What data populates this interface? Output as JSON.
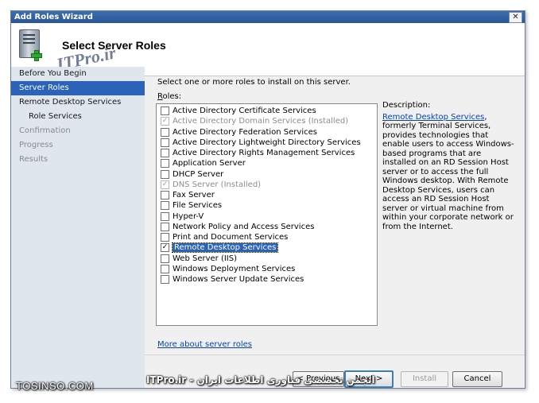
{
  "window": {
    "title": "Add Roles Wizard",
    "close_glyph": "✕"
  },
  "header": {
    "title": "Select Server Roles",
    "watermark": "ITPro.ir"
  },
  "sidebar": {
    "items": [
      {
        "label": "Before You Begin",
        "state": "normal",
        "indent": 0
      },
      {
        "label": "Server Roles",
        "state": "active",
        "indent": 0
      },
      {
        "label": "Remote Desktop Services",
        "state": "normal",
        "indent": 0
      },
      {
        "label": "Role Services",
        "state": "normal",
        "indent": 1
      },
      {
        "label": "Confirmation",
        "state": "disabled",
        "indent": 0
      },
      {
        "label": "Progress",
        "state": "disabled",
        "indent": 0
      },
      {
        "label": "Results",
        "state": "disabled",
        "indent": 0
      }
    ]
  },
  "main": {
    "instruction": "Select one or more roles to install on this server.",
    "roles_label_access": "R",
    "roles_label_rest": "oles:",
    "roles": [
      {
        "label": "Active Directory Certificate Services",
        "checked": false,
        "disabled": false,
        "selected": false
      },
      {
        "label": "Active Directory Domain Services  (Installed)",
        "checked": true,
        "disabled": true,
        "selected": false
      },
      {
        "label": "Active Directory Federation Services",
        "checked": false,
        "disabled": false,
        "selected": false
      },
      {
        "label": "Active Directory Lightweight Directory Services",
        "checked": false,
        "disabled": false,
        "selected": false
      },
      {
        "label": "Active Directory Rights Management Services",
        "checked": false,
        "disabled": false,
        "selected": false
      },
      {
        "label": "Application Server",
        "checked": false,
        "disabled": false,
        "selected": false
      },
      {
        "label": "DHCP Server",
        "checked": false,
        "disabled": false,
        "selected": false
      },
      {
        "label": "DNS Server  (Installed)",
        "checked": true,
        "disabled": true,
        "selected": false
      },
      {
        "label": "Fax Server",
        "checked": false,
        "disabled": false,
        "selected": false
      },
      {
        "label": "File Services",
        "checked": false,
        "disabled": false,
        "selected": false
      },
      {
        "label": "Hyper-V",
        "checked": false,
        "disabled": false,
        "selected": false
      },
      {
        "label": "Network Policy and Access Services",
        "checked": false,
        "disabled": false,
        "selected": false
      },
      {
        "label": "Print and Document Services",
        "checked": false,
        "disabled": false,
        "selected": false
      },
      {
        "label": "Remote Desktop Services",
        "checked": true,
        "disabled": false,
        "selected": true
      },
      {
        "label": "Web Server (IIS)",
        "checked": false,
        "disabled": false,
        "selected": false
      },
      {
        "label": "Windows Deployment Services",
        "checked": false,
        "disabled": false,
        "selected": false
      },
      {
        "label": "Windows Server Update Services",
        "checked": false,
        "disabled": false,
        "selected": false
      }
    ],
    "more_link": "More about server roles",
    "description": {
      "heading": "Description:",
      "link": "Remote Desktop Services",
      "text": ", formerly Terminal Services, provides technologies that enable users to access Windows-based programs that are installed on an RD Session Host server or to access the full Windows desktop. With Remote Desktop Services, users can access an RD Session Host server or virtual machine from within your corporate network or from the Internet."
    }
  },
  "buttons": {
    "previous": "< Previous",
    "next": "Next >",
    "install": "Install",
    "cancel": "Cancel"
  },
  "overlay": {
    "site": "TOSINSO.COM",
    "banner": "انجمن تخصصی فناوری اطلاعات ایران - ITPro.ir"
  }
}
